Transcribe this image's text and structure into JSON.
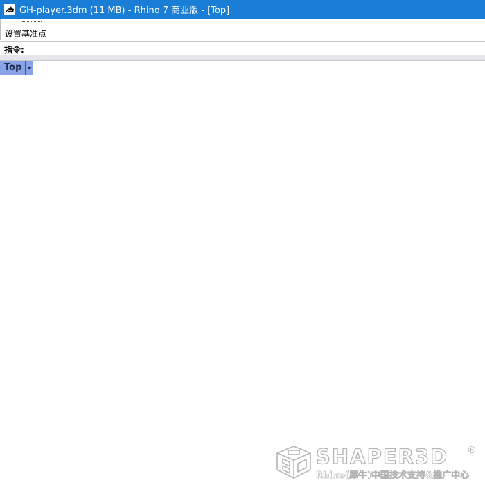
{
  "window": {
    "title": "GH-player.3dm (11 MB) - Rhino 7 商业版 - [Top]",
    "titlebar_color": "#1a7ed6"
  },
  "command": {
    "history": [
      "设置基准点"
    ],
    "prompt_label": "指令:",
    "input_value": ""
  },
  "viewport": {
    "tab_label": "Top",
    "tab_color": "#8aa2e8",
    "dropdown_icon": "triangle-down-icon"
  },
  "watermark": {
    "brand": "SHAPER3D",
    "registered_mark": "®",
    "subtitle": "Rhino(犀牛)中国技术支持&推广中心",
    "logo_icon": "isometric-cube-icon"
  }
}
